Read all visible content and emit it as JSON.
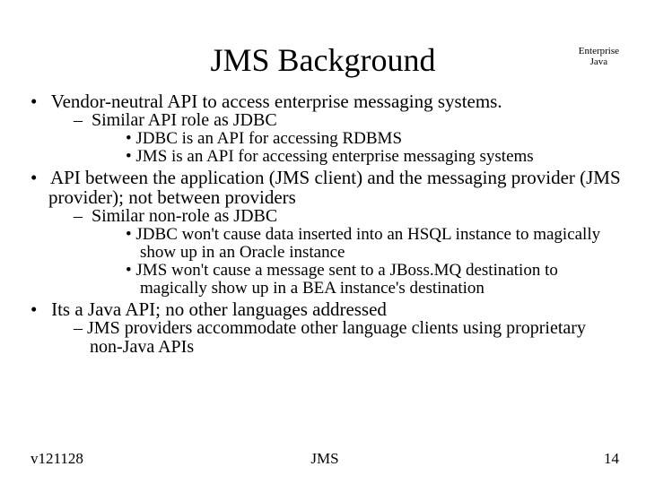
{
  "title": "JMS Background",
  "corner": {
    "line1": "Enterprise",
    "line2": "Java"
  },
  "bullets": {
    "b1": "Vendor-neutral API to access enterprise messaging systems.",
    "b1_s1": "Similar API role as JDBC",
    "b1_s1_d1": "JDBC is an API for accessing RDBMS",
    "b1_s1_d2": "JMS is an API for accessing enterprise messaging systems",
    "b2": "API between the application (JMS client) and the messaging provider (JMS provider); not between providers",
    "b2_s1": "Similar non-role as JDBC",
    "b2_s1_d1": "JDBC won't cause data inserted into an HSQL instance to magically show up in an Oracle instance",
    "b2_s1_d2": "JMS won't cause a message sent to a JBoss.MQ destination to magically show up in a BEA instance's destination",
    "b3": "Its a Java API; no other languages addressed",
    "b3_s1": "JMS providers accommodate other language clients using proprietary non-Java APIs"
  },
  "footer": {
    "left": "v121128",
    "center": "JMS",
    "right": "14"
  }
}
